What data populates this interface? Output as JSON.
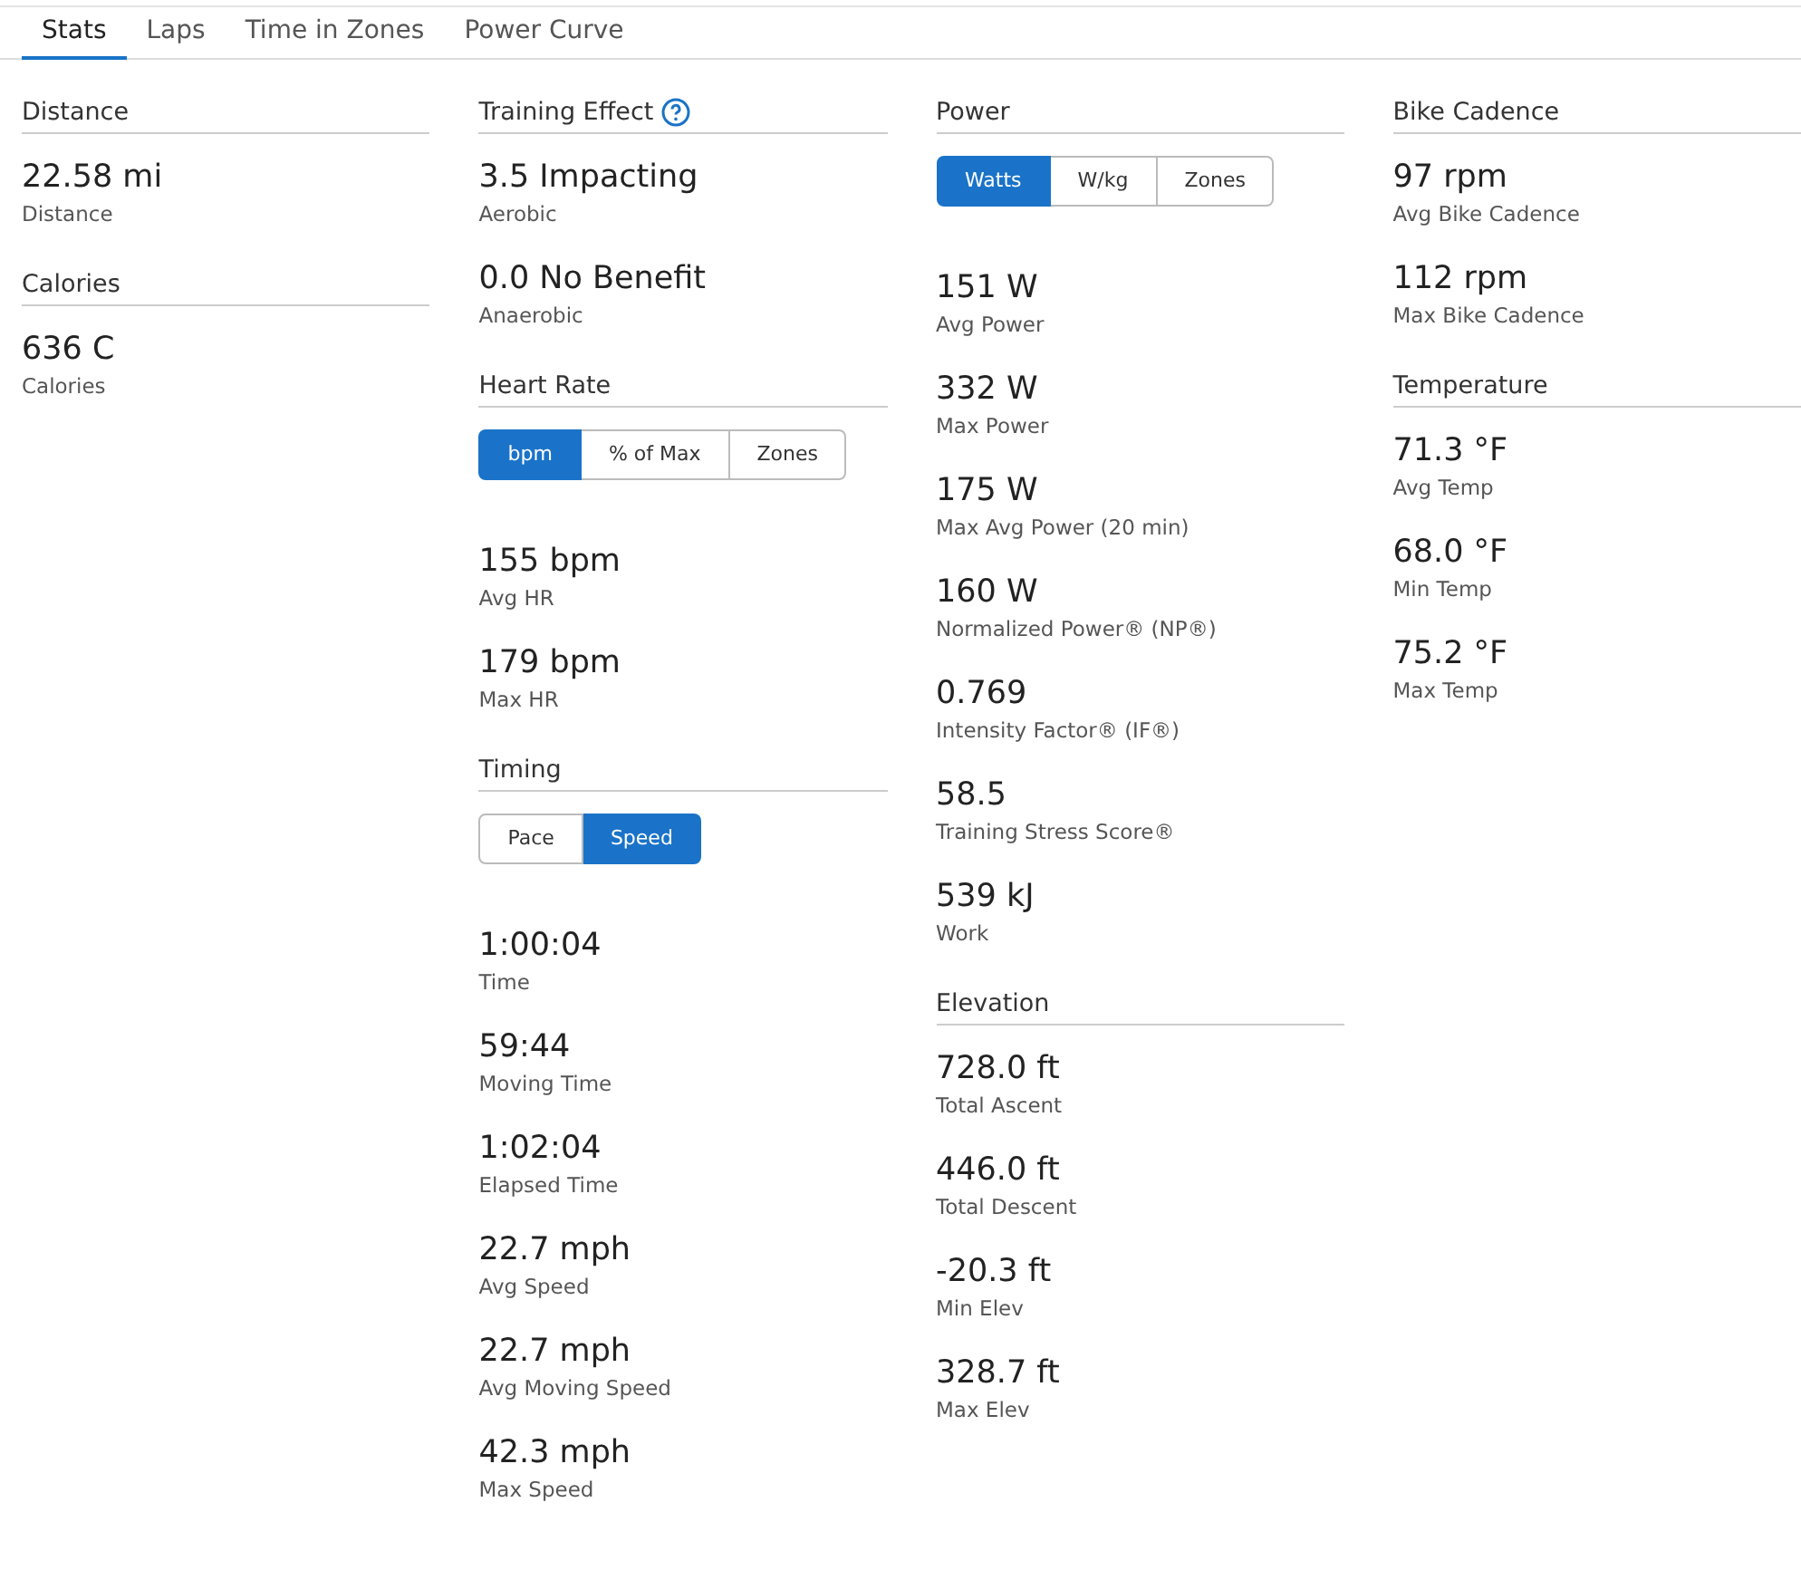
{
  "tabs": [
    {
      "label": "Stats",
      "selected": true
    },
    {
      "label": "Laps",
      "selected": false
    },
    {
      "label": "Time in Zones",
      "selected": false
    },
    {
      "label": "Power Curve",
      "selected": false
    }
  ],
  "columns": [
    {
      "sections": [
        {
          "title": "Distance",
          "stats": [
            {
              "value": "22.58 mi",
              "label": "Distance"
            }
          ]
        },
        {
          "title": "Calories",
          "stats": [
            {
              "value": "636 C",
              "label": "Calories"
            }
          ]
        }
      ]
    },
    {
      "sections": [
        {
          "title": "Training Effect",
          "help": true,
          "stats": [
            {
              "value": "3.5 Impacting",
              "label": "Aerobic"
            },
            {
              "value": "0.0 No Benefit",
              "label": "Anaerobic"
            }
          ]
        },
        {
          "title": "Heart Rate",
          "toggle": [
            {
              "label": "bpm",
              "selected": true
            },
            {
              "label": "% of Max",
              "selected": false
            },
            {
              "label": "Zones",
              "selected": false
            }
          ],
          "stats": [
            {
              "value": "155 bpm",
              "label": "Avg HR"
            },
            {
              "value": "179 bpm",
              "label": "Max HR"
            }
          ]
        },
        {
          "title": "Timing",
          "toggle": [
            {
              "label": "Pace",
              "selected": false
            },
            {
              "label": "Speed",
              "selected": true
            }
          ],
          "stats": [
            {
              "value": "1:00:04",
              "label": "Time"
            },
            {
              "value": "59:44",
              "label": "Moving Time"
            },
            {
              "value": "1:02:04",
              "label": "Elapsed Time"
            },
            {
              "value": "22.7 mph",
              "label": "Avg Speed"
            },
            {
              "value": "22.7 mph",
              "label": "Avg Moving Speed"
            },
            {
              "value": "42.3 mph",
              "label": "Max Speed"
            }
          ]
        }
      ]
    },
    {
      "sections": [
        {
          "title": "Power",
          "toggle": [
            {
              "label": "Watts",
              "selected": true
            },
            {
              "label": "W/kg",
              "selected": false
            },
            {
              "label": "Zones",
              "selected": false
            }
          ],
          "stats": [
            {
              "value": "151 W",
              "label": "Avg Power"
            },
            {
              "value": "332 W",
              "label": "Max Power"
            },
            {
              "value": "175 W",
              "label": "Max Avg Power (20 min)"
            },
            {
              "value": "160 W",
              "label": "Normalized Power® (NP®)"
            },
            {
              "value": "0.769",
              "label": "Intensity Factor® (IF®)"
            },
            {
              "value": "58.5",
              "label": "Training Stress Score®"
            },
            {
              "value": "539 kJ",
              "label": "Work"
            }
          ]
        },
        {
          "title": "Elevation",
          "stats": [
            {
              "value": "728.0 ft",
              "label": "Total Ascent"
            },
            {
              "value": "446.0 ft",
              "label": "Total Descent"
            },
            {
              "value": "-20.3 ft",
              "label": "Min Elev"
            },
            {
              "value": "328.7 ft",
              "label": "Max Elev"
            }
          ]
        }
      ]
    },
    {
      "sections": [
        {
          "title": "Bike Cadence",
          "stats": [
            {
              "value": "97 rpm",
              "label": "Avg Bike Cadence"
            },
            {
              "value": "112 rpm",
              "label": "Max Bike Cadence"
            }
          ]
        },
        {
          "title": "Temperature",
          "stats": [
            {
              "value": "71.3 °F",
              "label": "Avg Temp"
            },
            {
              "value": "68.0 °F",
              "label": "Min Temp"
            },
            {
              "value": "75.2 °F",
              "label": "Max Temp"
            }
          ]
        }
      ]
    }
  ]
}
